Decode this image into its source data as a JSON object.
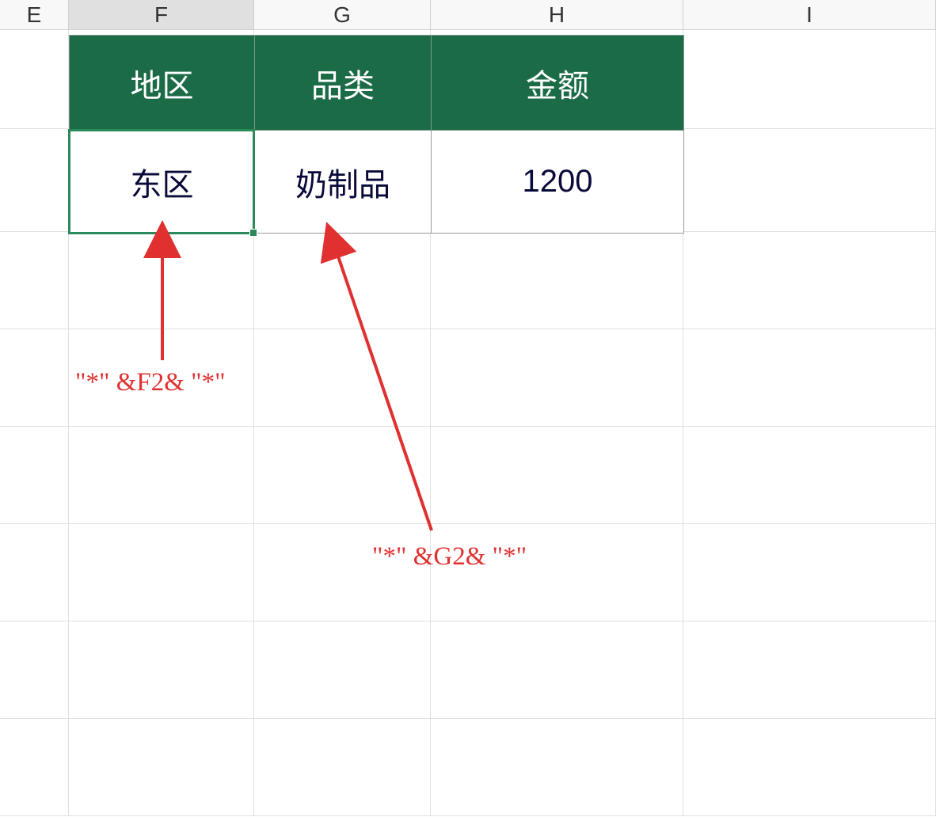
{
  "columns": {
    "E": "E",
    "F": "F",
    "G": "G",
    "H": "H",
    "I": "I"
  },
  "table": {
    "headers": {
      "region": "地区",
      "category": "品类",
      "amount": "金额"
    },
    "data_row": {
      "region": "东区",
      "category": "奶制品",
      "amount": "1200"
    }
  },
  "annotations": {
    "formula_f2": "\"*\" &F2& \"*\"",
    "formula_g2": "\"*\" &G2& \"*\""
  },
  "colors": {
    "header_bg": "#1b6b47",
    "selection": "#2a8a5a",
    "annotation": "#e03030"
  }
}
